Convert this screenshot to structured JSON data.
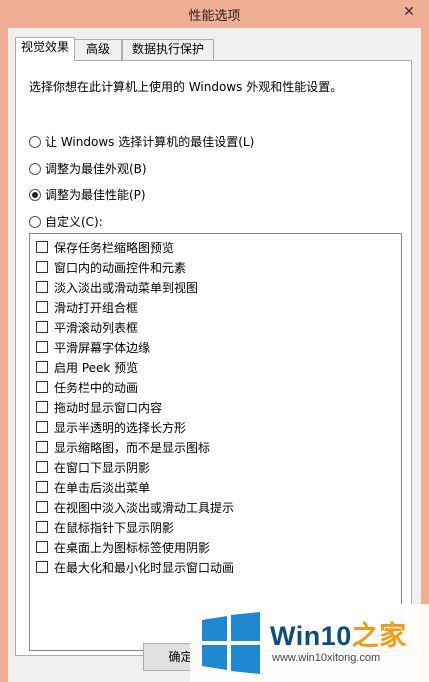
{
  "window": {
    "title": "性能选项",
    "close_glyph": "✕"
  },
  "tabs": [
    {
      "label": "视觉效果",
      "active": true
    },
    {
      "label": "高级",
      "active": false
    },
    {
      "label": "数据执行保护",
      "active": false
    }
  ],
  "description": "选择你想在此计算机上使用的 Windows 外观和性能设置。",
  "radios": [
    {
      "label": "让 Windows 选择计算机的最佳设置(L)",
      "checked": false
    },
    {
      "label": "调整为最佳外观(B)",
      "checked": false
    },
    {
      "label": "调整为最佳性能(P)",
      "checked": true
    },
    {
      "label": "自定义(C):",
      "checked": false
    }
  ],
  "options": [
    {
      "label": "保存任务栏缩略图预览",
      "checked": false
    },
    {
      "label": "窗口内的动画控件和元素",
      "checked": false
    },
    {
      "label": "淡入淡出或滑动菜单到视图",
      "checked": false
    },
    {
      "label": "滑动打开组合框",
      "checked": false
    },
    {
      "label": "平滑滚动列表框",
      "checked": false
    },
    {
      "label": "平滑屏幕字体边缘",
      "checked": false
    },
    {
      "label": "启用 Peek 预览",
      "checked": false
    },
    {
      "label": "任务栏中的动画",
      "checked": false
    },
    {
      "label": "拖动时显示窗口内容",
      "checked": false
    },
    {
      "label": "显示半透明的选择长方形",
      "checked": false
    },
    {
      "label": "显示缩略图，而不是显示图标",
      "checked": false
    },
    {
      "label": "在窗口下显示阴影",
      "checked": false
    },
    {
      "label": "在单击后淡出菜单",
      "checked": false
    },
    {
      "label": "在视图中淡入淡出或滑动工具提示",
      "checked": false
    },
    {
      "label": "在鼠标指针下显示阴影",
      "checked": false
    },
    {
      "label": "在桌面上为图标标签使用阴影",
      "checked": false
    },
    {
      "label": "在最大化和最小化时显示窗口动画",
      "checked": false
    }
  ],
  "buttons": {
    "ok_label": "确定"
  },
  "watermark": {
    "brand_prefix": "Win10",
    "brand_accent": "之家",
    "website": "www.win10xitong.com",
    "logo_icon": "windows-logo-icon"
  },
  "colors": {
    "titlebar": "#f0ae95",
    "logo_blue": "#1e88d0",
    "brand_blue": "#0a4e7d",
    "brand_orange": "#f39c12"
  }
}
